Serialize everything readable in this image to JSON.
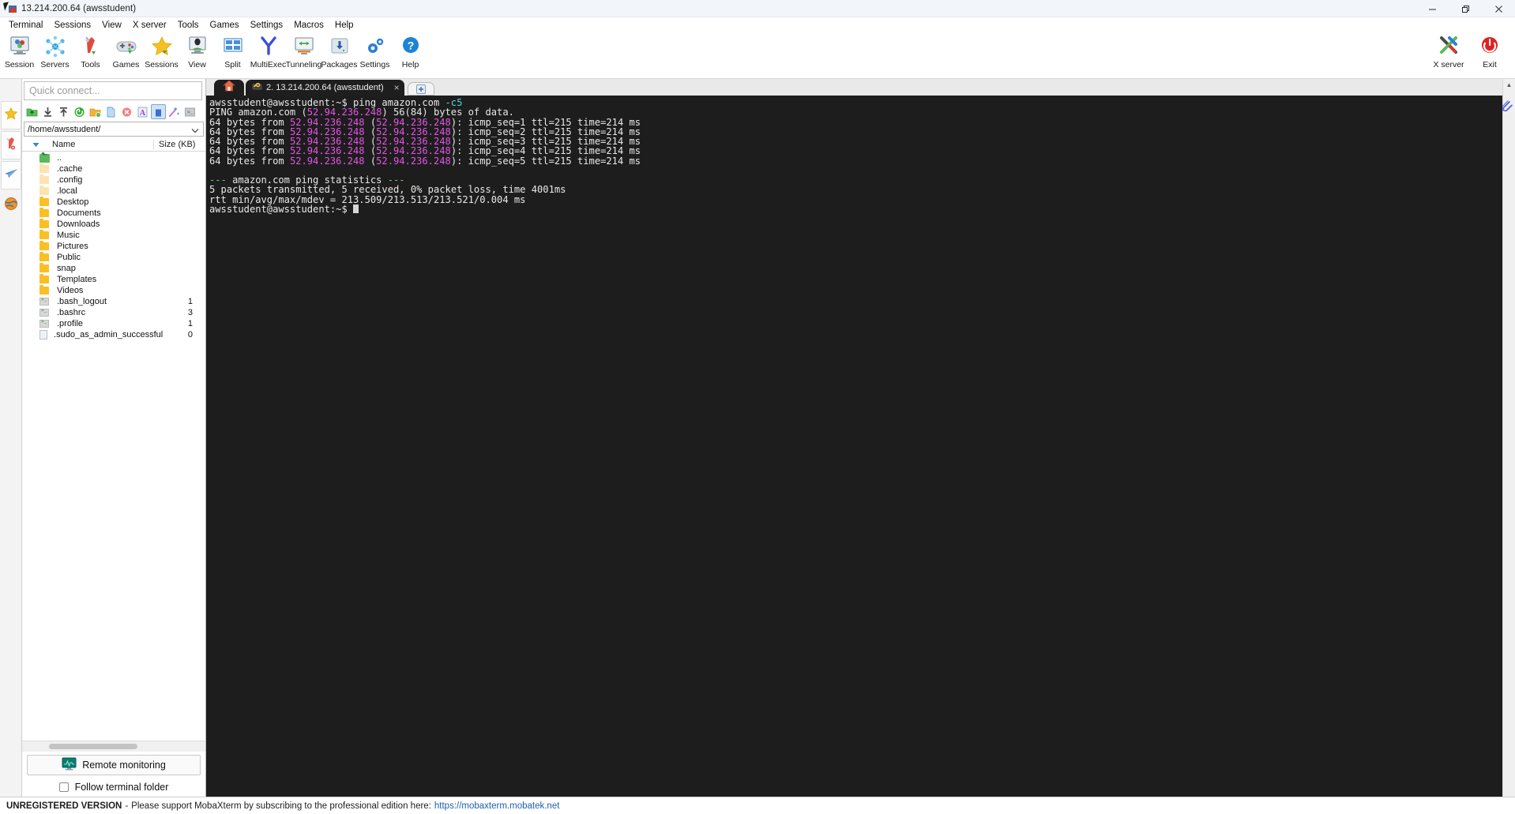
{
  "window": {
    "title": "13.214.200.64 (awsstudent)",
    "controls": {
      "minimize": "minimize-icon",
      "maximize": "restore-icon",
      "close": "close-icon"
    }
  },
  "menubar": {
    "items": [
      {
        "label": "Terminal"
      },
      {
        "label": "Sessions"
      },
      {
        "label": "View"
      },
      {
        "label": "X server"
      },
      {
        "label": "Tools"
      },
      {
        "label": "Games"
      },
      {
        "label": "Settings"
      },
      {
        "label": "Macros"
      },
      {
        "label": "Help"
      }
    ]
  },
  "toolbar": {
    "items": [
      {
        "label": "Session",
        "icon": "session-icon"
      },
      {
        "label": "Servers",
        "icon": "servers-icon"
      },
      {
        "label": "Tools",
        "icon": "tools-icon"
      },
      {
        "label": "Games",
        "icon": "games-icon"
      },
      {
        "label": "Sessions",
        "icon": "sessions-star-icon"
      },
      {
        "label": "View",
        "icon": "view-icon"
      },
      {
        "label": "Split",
        "icon": "split-icon"
      },
      {
        "label": "MultiExec",
        "icon": "multiexec-icon"
      },
      {
        "label": "Tunneling",
        "icon": "tunneling-icon"
      },
      {
        "label": "Packages",
        "icon": "packages-icon"
      },
      {
        "label": "Settings",
        "icon": "settings-gear-icon"
      },
      {
        "label": "Help",
        "icon": "help-icon"
      }
    ],
    "right_items": [
      {
        "label": "X server",
        "icon": "xserver-icon"
      },
      {
        "label": "Exit",
        "icon": "exit-power-icon"
      }
    ]
  },
  "sidebar": {
    "quick_connect_placeholder": "Quick connect...",
    "vertical_tabs": [
      {
        "name": "favorites-tab",
        "icon": "star-icon"
      },
      {
        "name": "sftp-tab",
        "icon": "sftp-thermometer-icon"
      },
      {
        "name": "macros-tab",
        "icon": "paper-plane-icon"
      },
      {
        "name": "tools-tab",
        "icon": "globe-icon"
      }
    ],
    "sftp_toolbar": [
      {
        "name": "go-up-button",
        "icon": "folder-up-icon"
      },
      {
        "name": "download-button",
        "icon": "download-arrow-icon"
      },
      {
        "name": "upload-button",
        "icon": "upload-arrow-icon"
      },
      {
        "name": "refresh-button",
        "icon": "refresh-icon"
      },
      {
        "name": "new-folder-button",
        "icon": "new-folder-icon"
      },
      {
        "name": "new-file-button",
        "icon": "new-file-icon"
      },
      {
        "name": "delete-button",
        "icon": "delete-x-icon"
      },
      {
        "name": "text-mode-button",
        "icon": "text-a-icon"
      },
      {
        "name": "binary-mode-button",
        "icon": "binary-mode-icon"
      },
      {
        "name": "permissions-button",
        "icon": "magic-wand-icon"
      },
      {
        "name": "terminal-view-button",
        "icon": "terminal-box-icon"
      }
    ],
    "path": "/home/awsstudent/",
    "columns": {
      "name": "Name",
      "size": "Size (KB)"
    },
    "files": [
      {
        "name": "..",
        "size": "",
        "type": "parent"
      },
      {
        "name": ".cache",
        "size": "",
        "type": "folder-hidden"
      },
      {
        "name": ".config",
        "size": "",
        "type": "folder-hidden"
      },
      {
        "name": ".local",
        "size": "",
        "type": "folder-hidden"
      },
      {
        "name": "Desktop",
        "size": "",
        "type": "folder"
      },
      {
        "name": "Documents",
        "size": "",
        "type": "folder"
      },
      {
        "name": "Downloads",
        "size": "",
        "type": "folder"
      },
      {
        "name": "Music",
        "size": "",
        "type": "folder"
      },
      {
        "name": "Pictures",
        "size": "",
        "type": "folder"
      },
      {
        "name": "Public",
        "size": "",
        "type": "folder"
      },
      {
        "name": "snap",
        "size": "",
        "type": "folder"
      },
      {
        "name": "Templates",
        "size": "",
        "type": "folder"
      },
      {
        "name": "Videos",
        "size": "",
        "type": "folder"
      },
      {
        "name": ".bash_logout",
        "size": "1",
        "type": "script"
      },
      {
        "name": ".bashrc",
        "size": "3",
        "type": "script"
      },
      {
        "name": ".profile",
        "size": "1",
        "type": "script"
      },
      {
        "name": ".sudo_as_admin_successful",
        "size": "0",
        "type": "file"
      }
    ],
    "remote_monitoring_label": "Remote monitoring",
    "follow_terminal_folder_label": "Follow terminal folder",
    "follow_terminal_folder_checked": false
  },
  "tabs": {
    "home_tab_name": "home-tab",
    "session_tab_label": "2. 13.214.200.64 (awsstudent)",
    "close_label": "×",
    "new_tab_label": "+"
  },
  "terminal": {
    "lines": [
      {
        "segments": [
          {
            "text": "awsstudent@awsstudent:~$ ping amazon.com ",
            "color": "white"
          },
          {
            "text": "-c5",
            "color": "cyan"
          }
        ]
      },
      {
        "segments": [
          {
            "text": "PING amazon.com (",
            "color": "white"
          },
          {
            "text": "52.94.236.248",
            "color": "magenta"
          },
          {
            "text": ") 56(84) bytes of data.",
            "color": "white"
          }
        ]
      },
      {
        "segments": [
          {
            "text": "64 bytes from ",
            "color": "white"
          },
          {
            "text": "52.94.236.248",
            "color": "magenta"
          },
          {
            "text": " (",
            "color": "white"
          },
          {
            "text": "52.94.236.248",
            "color": "magenta"
          },
          {
            "text": "): icmp_seq=1 ttl=215 time=214 ms",
            "color": "white"
          }
        ]
      },
      {
        "segments": [
          {
            "text": "64 bytes from ",
            "color": "white"
          },
          {
            "text": "52.94.236.248",
            "color": "magenta"
          },
          {
            "text": " (",
            "color": "white"
          },
          {
            "text": "52.94.236.248",
            "color": "magenta"
          },
          {
            "text": "): icmp_seq=2 ttl=215 time=214 ms",
            "color": "white"
          }
        ]
      },
      {
        "segments": [
          {
            "text": "64 bytes from ",
            "color": "white"
          },
          {
            "text": "52.94.236.248",
            "color": "magenta"
          },
          {
            "text": " (",
            "color": "white"
          },
          {
            "text": "52.94.236.248",
            "color": "magenta"
          },
          {
            "text": "): icmp_seq=3 ttl=215 time=214 ms",
            "color": "white"
          }
        ]
      },
      {
        "segments": [
          {
            "text": "64 bytes from ",
            "color": "white"
          },
          {
            "text": "52.94.236.248",
            "color": "magenta"
          },
          {
            "text": " (",
            "color": "white"
          },
          {
            "text": "52.94.236.248",
            "color": "magenta"
          },
          {
            "text": "): icmp_seq=4 ttl=215 time=214 ms",
            "color": "white"
          }
        ]
      },
      {
        "segments": [
          {
            "text": "64 bytes from ",
            "color": "white"
          },
          {
            "text": "52.94.236.248",
            "color": "magenta"
          },
          {
            "text": " (",
            "color": "white"
          },
          {
            "text": "52.94.236.248",
            "color": "magenta"
          },
          {
            "text": "): icmp_seq=5 ttl=215 time=214 ms",
            "color": "white"
          }
        ]
      },
      {
        "segments": [
          {
            "text": "",
            "color": "white"
          }
        ]
      },
      {
        "segments": [
          {
            "text": "--- ",
            "color": "green"
          },
          {
            "text": "amazon.com ping statistics",
            "color": "white"
          },
          {
            "text": " ---",
            "color": "green"
          }
        ]
      },
      {
        "segments": [
          {
            "text": "5 packets transmitted, 5 received, 0% packet loss, time 4001ms",
            "color": "white"
          }
        ]
      },
      {
        "segments": [
          {
            "text": "rtt min/avg/max/mdev = 213.509/213.513/213.521/0.004 ms",
            "color": "white"
          }
        ]
      },
      {
        "segments": [
          {
            "text": "awsstudent@awsstudent:~$ ",
            "color": "white"
          },
          {
            "text": "█",
            "color": "cursor"
          }
        ]
      }
    ]
  },
  "statusbar": {
    "unregistered": "UNREGISTERED VERSION",
    "dash": "-",
    "message": "Please support MobaXterm by subscribing to the professional edition here:",
    "link": "https://mobaxterm.mobatek.net"
  },
  "colors": {
    "terminal_bg": "#1d1d1d",
    "terminal_fg": "#e8e8e8",
    "magenta": "#e454e4",
    "cyan": "#4fd6e0",
    "green": "#5fd75f",
    "accent_blue": "#1a5fb4",
    "exit_red": "#e02020"
  }
}
